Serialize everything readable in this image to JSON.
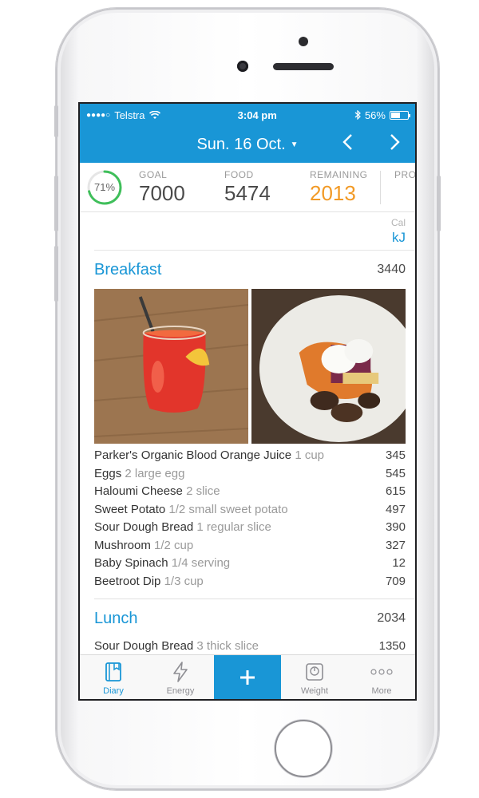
{
  "status_bar": {
    "carrier": "Telstra",
    "time": "3:04 pm",
    "battery": "56%",
    "battery_level": 0.56
  },
  "nav": {
    "title": "Sun. 16 Oct.",
    "prev": "<",
    "next": ">"
  },
  "summary": {
    "progress_label": "71%",
    "progress": 0.71,
    "goal_label": "GOAL",
    "goal_value": "7000",
    "food_label": "FOOD",
    "food_value": "5474",
    "remaining_label": "REMAINING",
    "remaining_value": "2013",
    "extra_label": "PRO"
  },
  "units": {
    "inactive": "Cal",
    "active": "kJ"
  },
  "breakfast": {
    "name": "Breakfast",
    "total": "3440",
    "items": [
      {
        "name": "Parker's Organic Blood Orange Juice",
        "qty": "1 cup",
        "value": "345"
      },
      {
        "name": "Eggs",
        "qty": "2 large egg",
        "value": "545"
      },
      {
        "name": "Haloumi Cheese",
        "qty": "2 slice",
        "value": "615"
      },
      {
        "name": "Sweet Potato",
        "qty": "1/2 small sweet potato",
        "value": "497"
      },
      {
        "name": "Sour Dough Bread",
        "qty": "1 regular slice",
        "value": "390"
      },
      {
        "name": "Mushroom",
        "qty": "1/2 cup",
        "value": "327"
      },
      {
        "name": "Baby Spinach",
        "qty": "1/4 serving",
        "value": "12"
      },
      {
        "name": "Beetroot Dip",
        "qty": "1/3 cup",
        "value": "709"
      }
    ]
  },
  "lunch": {
    "name": "Lunch",
    "total": "2034",
    "items": [
      {
        "name": "Sour Dough Bread",
        "qty": "3 thick slice",
        "value": "1350"
      }
    ]
  },
  "tabs": [
    {
      "label": "Diary",
      "icon": "diary-icon"
    },
    {
      "label": "Energy",
      "icon": "energy-icon"
    },
    {
      "label": "",
      "icon": "plus-icon"
    },
    {
      "label": "Weight",
      "icon": "scale-icon"
    },
    {
      "label": "More",
      "icon": "more-icon"
    }
  ],
  "colors": {
    "accent": "#1996d6",
    "remaining": "#f29a26",
    "ring": "#3fbf5a"
  }
}
